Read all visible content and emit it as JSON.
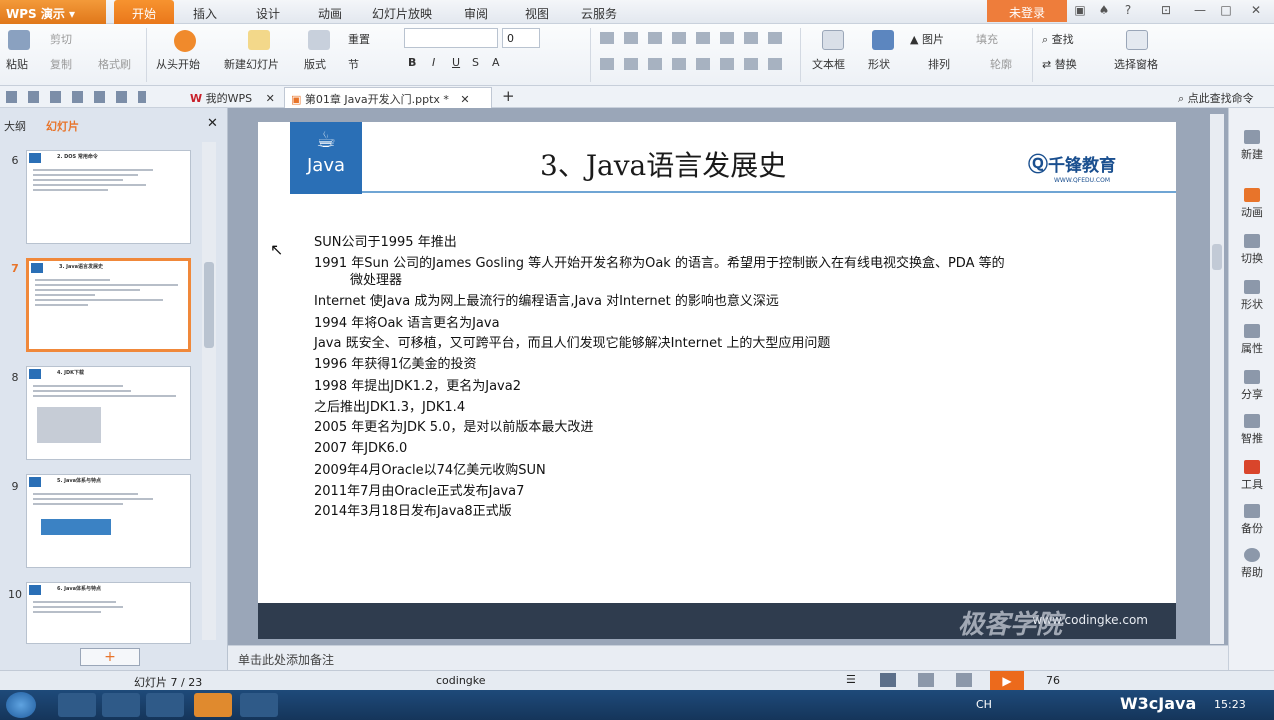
{
  "app": {
    "name": "WPS 演示"
  },
  "tabs": [
    "开始",
    "插入",
    "设计",
    "动画",
    "幻灯片放映",
    "审阅",
    "视图",
    "云服务"
  ],
  "login": "未登录",
  "ribbon": {
    "paste": "粘贴",
    "cut": "剪切",
    "copy": "复制",
    "format_painter": "格式刷",
    "from_start": "从头开始",
    "new_slide": "新建幻灯片",
    "layout": "版式",
    "reset": "重置",
    "section": "节",
    "font_size": "0",
    "textbox": "文本框",
    "shape": "形状",
    "picture": "图片",
    "fill": "填充",
    "arrange": "排列",
    "outline": "轮廓",
    "find": "查找",
    "replace": "替换",
    "select_pane": "选择窗格"
  },
  "doc_tabs": {
    "mywps": "我的WPS",
    "current": "第01章 Java开发入门.pptx *"
  },
  "search_cmd": "点此查找命令",
  "left": {
    "outline": "大纲",
    "slides": "幻灯片"
  },
  "thumbs": [
    {
      "num": "6",
      "title": "2. DOS 常用命令"
    },
    {
      "num": "7",
      "title": "3. Java语言发展史"
    },
    {
      "num": "8",
      "title": "4. JDK下载"
    },
    {
      "num": "9",
      "title": "5. Java体系与特点"
    },
    {
      "num": "10",
      "title": "6. Java体系与特点"
    }
  ],
  "slide": {
    "logo_text": "Java",
    "title": "3、Java语言发展史",
    "brand": "千锋教育",
    "brand_sub": "WWW.QFEDU.COM",
    "footer_url": "www.codingke.com",
    "lines": [
      "SUN公司于1995 年推出",
      "1991 年Sun 公司的James Gosling 等人开始开发名称为Oak 的语言。希望用于控制嵌入在有线电视交换盒、PDA 等的",
      "微处理器",
      "Internet 使Java 成为网上最流行的编程语言,Java 对Internet 的影响也意义深远",
      "1994 年将Oak 语言更名为Java",
      "Java 既安全、可移植，又可跨平台，而且人们发现它能够解决Internet 上的大型应用问题",
      "1996 年获得1亿美金的投资",
      "1998 年提出JDK1.2，更名为Java2",
      "之后推出JDK1.3，JDK1.4",
      "2005 年更名为JDK 5.0，是对以前版本最大改进",
      "2007 年JDK6.0",
      "2009年4月Oracle以74亿美元收购SUN",
      "2011年7月由Oracle正式发布Java7",
      "2014年3月18日发布Java8正式版"
    ]
  },
  "right": [
    "新建",
    "动画",
    "切换",
    "形状",
    "属性",
    "分享",
    "智推",
    "工具",
    "备份",
    "帮助"
  ],
  "notes": "单击此处添加备注",
  "status": {
    "slide": "幻灯片 7 / 23",
    "theme": "codingke",
    "zoom": "76"
  },
  "watermark": "极客学院",
  "w3": "W3cJava",
  "clock": "15:23",
  "lang": "CH"
}
